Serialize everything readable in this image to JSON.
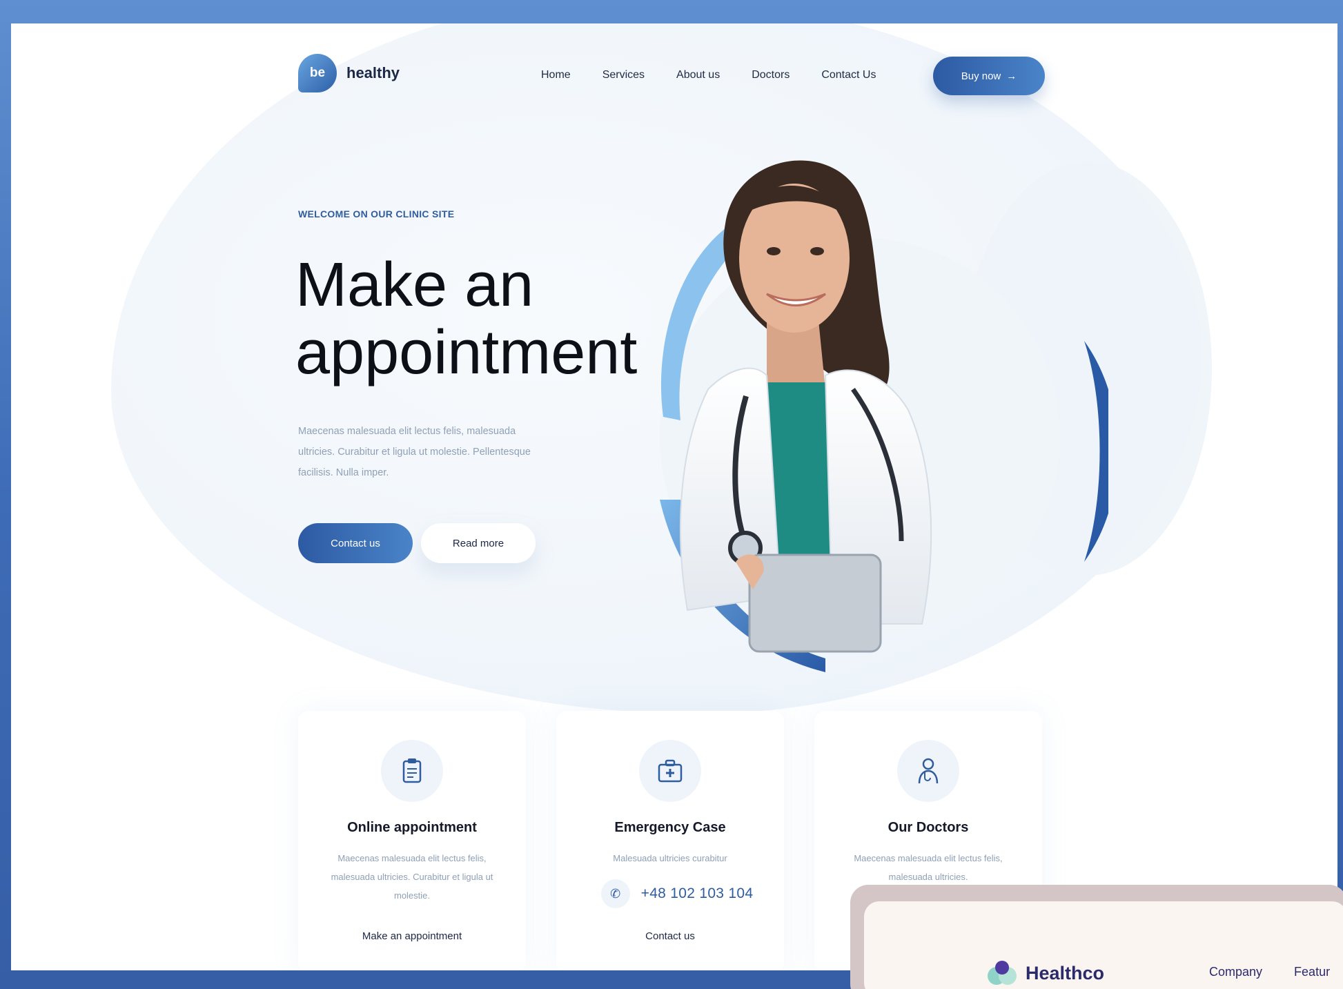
{
  "brand": {
    "mark": "be",
    "name": "healthy"
  },
  "nav": {
    "items": [
      "Home",
      "Services",
      "About us",
      "Doctors",
      "Contact Us"
    ],
    "cta_label": "Buy now",
    "cta_arrow": "→"
  },
  "hero": {
    "eyebrow": "WELCOME ON OUR CLINIC SITE",
    "title_line1": "Make an",
    "title_line2": "appointment",
    "text": "Maecenas malesuada elit lectus felis, malesuada ultricies. Curabitur et ligula ut molestie. Pellentesque facilisis. Nulla imper.",
    "primary_label": "Contact us",
    "secondary_label": "Read more"
  },
  "cards": [
    {
      "icon": "clipboard-icon",
      "title": "Online appointment",
      "text": "Maecenas malesuada elit lectus felis, malesuada ultricies. Curabitur et ligula ut molestie.",
      "cta": "Make an appointment"
    },
    {
      "icon": "medical-kit-icon",
      "title": "Emergency Case",
      "text": "Malesuada ultricies curabitur",
      "phone": "+48 102 103 104",
      "cta": "Contact us"
    },
    {
      "icon": "doctor-icon",
      "title": "Our Doctors",
      "text": "Maecenas malesuada elit lectus felis, malesuada ultricies.",
      "cta": ""
    }
  ],
  "second_screen": {
    "brand": "Healthco",
    "nav": [
      "Company",
      "Featur"
    ]
  },
  "colors": {
    "primary": "#2d5aa3",
    "accent": "#4a84c8",
    "frame": "#3f6cb7",
    "heading": "#0d1117",
    "muted": "#8fa0b6"
  }
}
